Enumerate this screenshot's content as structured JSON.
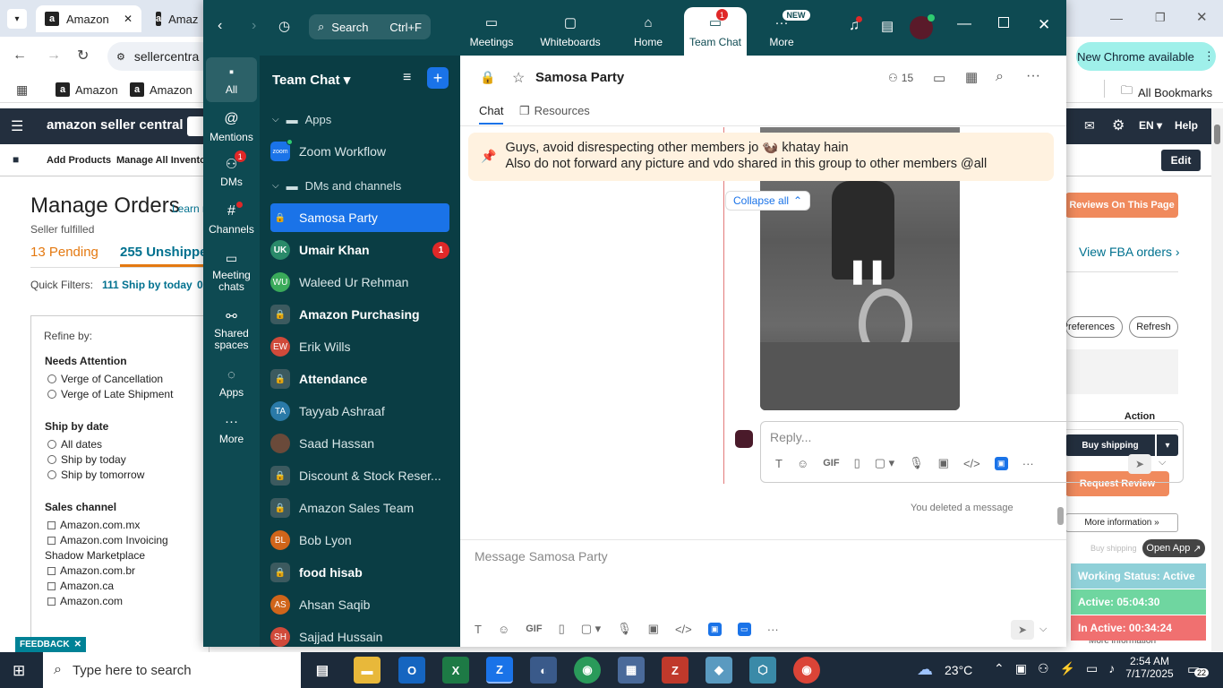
{
  "chrome": {
    "tab1": "Amazon",
    "tab2": "Amaz",
    "url": "sellercentra",
    "bookmark1": "Amazon",
    "bookmark2": "Amazon",
    "all_bookmarks": "All Bookmarks",
    "update_banner": "New Chrome available"
  },
  "amazon": {
    "logo": "amazon seller central",
    "nav_lang": "EN",
    "nav_help": "Help",
    "sub_add": "Add Products",
    "sub_manage": "Manage All Inventor",
    "edit": "Edit",
    "title": "Manage Orders",
    "learn": "Learn m",
    "fulfilled": "Seller fulfilled",
    "pending": "13 Pending",
    "unshipped": "255 Unshippe",
    "quick_filters": "Quick Filters:",
    "ship_today_filter": "111 Ship by today",
    "ship_today_extra": "0",
    "refine": "Refine by:",
    "needs_attention": "Needs Attention",
    "opt_cancel": "Verge of Cancellation",
    "opt_late": "Verge of Late Shipment",
    "ship_by_date": "Ship by date",
    "opt_all": "All dates",
    "opt_today": "Ship by today",
    "opt_tomorrow": "Ship by tomorrow",
    "sales_channel": "Sales channel",
    "ch1": "Amazon.com.mx",
    "ch2": "Amazon.com Invoicing",
    "ch2b": "Shadow Marketplace",
    "ch3": "Amazon.com.br",
    "ch4": "Amazon.ca",
    "ch5": "Amazon.com",
    "feedback": "FEEDBACK",
    "reviews_btn": "Reviews On This Page",
    "fba_link": "View FBA orders",
    "preferences": "Preferences",
    "refresh": "Refresh",
    "action_col": "Action",
    "buy_shipping": "Buy shipping",
    "request_review": "Request Review",
    "more_info": "More information",
    "buy_shipping2": "Buy shipping",
    "more_info2": "More information"
  },
  "zoom": {
    "search": "Search",
    "search_shortcut": "Ctrl+F",
    "nav": [
      "Meetings",
      "Whiteboards",
      "Home",
      "Team Chat",
      "More"
    ],
    "team_chat_badge": "1",
    "new_badge": "NEW",
    "rail": {
      "all": "All",
      "mentions": "Mentions",
      "dms": "DMs",
      "dms_badge": "1",
      "channels": "Channels",
      "meeting_chats": "Meeting chats",
      "shared_spaces": "Shared spaces",
      "apps": "Apps",
      "more": "More"
    },
    "list_title": "Team Chat",
    "apps_section": "Apps",
    "zoom_workflow": "Zoom Workflow",
    "dms_section": "DMs and channels",
    "items": [
      {
        "name": "Samosa Party",
        "initials": ""
      },
      {
        "name": "Umair Khan",
        "initials": "UK",
        "badge": "1"
      },
      {
        "name": "Waleed Ur Rehman",
        "initials": "WU"
      },
      {
        "name": "Amazon Purchasing",
        "initials": ""
      },
      {
        "name": "Erik Wills",
        "initials": "EW"
      },
      {
        "name": "Attendance",
        "initials": ""
      },
      {
        "name": "Tayyab Ashraaf",
        "initials": "TA"
      },
      {
        "name": "Saad Hassan",
        "initials": ""
      },
      {
        "name": "Discount & Stock Reser...",
        "initials": ""
      },
      {
        "name": "Amazon Sales Team",
        "initials": ""
      },
      {
        "name": "Bob Lyon",
        "initials": "BL"
      },
      {
        "name": "food hisab",
        "initials": ""
      },
      {
        "name": "Ahsan Saqib",
        "initials": "AS"
      },
      {
        "name": "Sajjad Hussain",
        "initials": "SH"
      }
    ],
    "channel_name": "Samosa Party",
    "member_count": "15",
    "tab_chat": "Chat",
    "tab_resources": "Resources",
    "pinned_line1": "Guys, avoid disrespecting other members jo 🦦 khatay hain",
    "pinned_line2": "Also do not forward any picture and vdo shared in this group to other members @all",
    "collapse_all": "Collapse all",
    "reply_placeholder": "Reply...",
    "deleted_note": "You deleted a message",
    "message_placeholder": "Message Samosa Party",
    "gif": "GIF"
  },
  "overlay": {
    "open_app": "Open App",
    "working_status": "Working Status: Active",
    "active": "Active: 05:04:30",
    "inactive": "In Active: 00:34:24"
  },
  "taskbar": {
    "search_placeholder": "Type here to search",
    "temp": "23°C",
    "time": "2:54 AM",
    "date": "7/17/2025",
    "notif_count": "22"
  },
  "colors": {
    "zoom_dark": "#0e4a52",
    "zoom_blue": "#1a73e8",
    "amazon_nav": "#232f3e",
    "amazon_orange": "#f08a5d",
    "status_green": "#6fd6a0",
    "status_red": "#f07070"
  }
}
